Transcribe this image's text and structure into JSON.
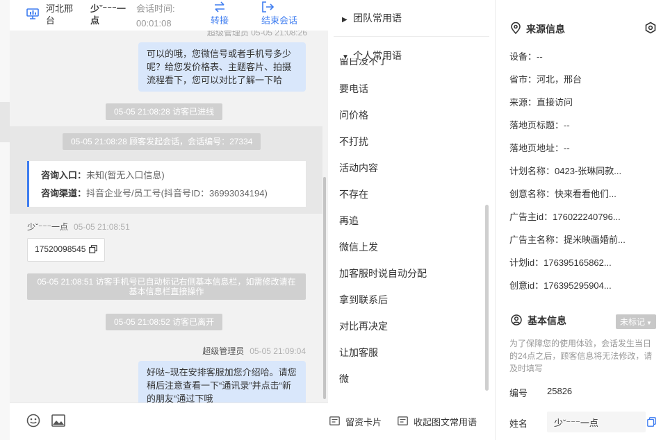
{
  "header": {
    "location": "河北邢台",
    "customer_name": "少ˇ⁻⁻⁻一点",
    "session_time_label": "会话时间:",
    "session_time_value": "00:01:08",
    "transfer_label": "转接",
    "end_label": "结束会话"
  },
  "chat": {
    "top_partial_sender": "超级管理员 05-05 21:08:26",
    "msg1": "可以的哦，您微信号或者手机号多少呢？给您发价格表、主题客片、拍摄流程看下，您可以对比了解一下哈",
    "sys_entered": "05-05 21:08:28 访客已进线",
    "sys_session_started": "05-05 21:08:28 顾客发起会话，会话编号：27334",
    "info_entry_label": "咨询入口：",
    "info_entry_value": "未知(暂无入口信息)",
    "info_channel_label": "咨询渠道：",
    "info_channel_value": "抖音企业号/员工号(抖音号ID：36993034194)",
    "visitor_sender": "少ˇ⁻⁻⁻一点",
    "visitor_time": "05-05 21:08:51",
    "visitor_phone": "17520098545",
    "sys_phone_marked": "05-05 21:08:51 访客手机号已自动标记右侧基本信息栏，如需修改请在基本信息栏直接操作",
    "sys_left": "05-05 21:08:52 访客已离开",
    "admin_sender": "超级管理员",
    "admin_time": "05-05 21:09:04",
    "msg2": "好哒~现在安排客服加您介绍哈。请您稍后注意查看一下“通讯录”并点击“新的朋友”通过下哦"
  },
  "phrases": {
    "team_group": "团队常用语",
    "personal_group": "个人常用语",
    "partial_top": "留白没不了",
    "items": [
      "要电话",
      "问价格",
      "不打扰",
      "活动内容",
      "不存在",
      "再追",
      "微信上发",
      "加客服时说自动分配",
      "拿到联系后",
      "对比再决定",
      "让加客服",
      "微"
    ],
    "leave_card_label": "留资卡片",
    "collapse_label": "收起图文常用语"
  },
  "source_info": {
    "title": "来源信息",
    "rows": [
      {
        "k": "设备：",
        "v": "--"
      },
      {
        "k": "省市：",
        "v": "河北，邢台"
      },
      {
        "k": "来源：",
        "v": "直接访问"
      },
      {
        "k": "落地页标题：",
        "v": "--"
      },
      {
        "k": "落地页地址：",
        "v": "--"
      },
      {
        "k": "计划名称：",
        "v": "0423-张琳同款..."
      },
      {
        "k": "创意名称：",
        "v": "快来看看他们..."
      },
      {
        "k": "广告主id：",
        "v": "176022240796..."
      },
      {
        "k": "广告主名称：",
        "v": "提米映画婚前..."
      },
      {
        "k": "计划id：",
        "v": "176395165862..."
      },
      {
        "k": "创意id：",
        "v": "176395295904..."
      }
    ]
  },
  "basic_info": {
    "title": "基本信息",
    "tag": "未标记",
    "notice": "为了保障您的使用体验，会话发生当日的24点之后，顾客信息将无法修改，请及时填写",
    "number_label": "编号",
    "number_value": "25826",
    "name_label": "姓名",
    "name_value": "少ˇ⁻⁻⁻一点"
  },
  "colors": {
    "accent": "#3d7cf0",
    "bubble": "#d9e7fb",
    "system_pill": "#d0d0d0"
  }
}
